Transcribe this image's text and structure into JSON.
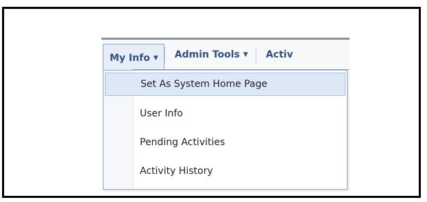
{
  "menubar": {
    "tabs": [
      {
        "label": "My Info",
        "caret": "▼",
        "active": true
      },
      {
        "label": "Admin Tools",
        "caret": "▼",
        "active": false
      },
      {
        "label": "Activ",
        "caret": "",
        "active": false
      }
    ]
  },
  "dropdown": {
    "items": [
      {
        "label": "Set As System Home Page",
        "highlighted": true
      },
      {
        "label": "User Info",
        "highlighted": false
      },
      {
        "label": "Pending Activities",
        "highlighted": false
      },
      {
        "label": "Activity History",
        "highlighted": false
      }
    ]
  },
  "colors": {
    "menu_text": "#34507a",
    "active_tab_bg": "#e7eef8",
    "highlight_bg": "#dde7f5",
    "border": "#8ea8cb",
    "frame": "#000000"
  }
}
